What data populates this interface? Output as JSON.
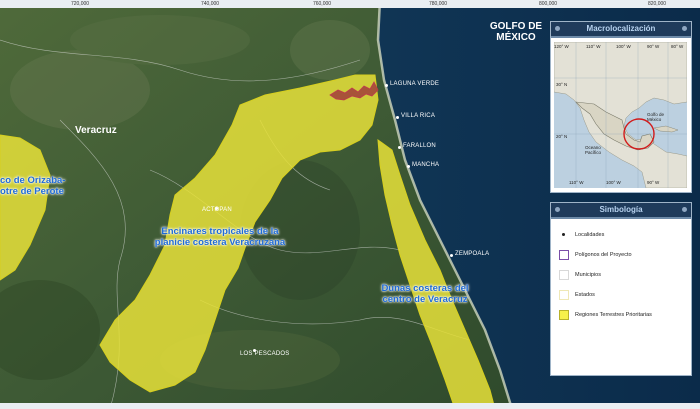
{
  "map": {
    "coord_labels": [
      "720,000",
      "740,000",
      "760,000",
      "780,000",
      "800,000",
      "820,000"
    ],
    "state_label": "Veracruz",
    "gulf_label": "GOLFO DE MÉXICO",
    "places": {
      "laguna_verde": "LAGUNA VERDE",
      "villa_rica": "VILLA RICA",
      "farallon": "FARALLON",
      "mancha": "MANCHA",
      "actopan": "ACTOPAN",
      "zempoala": "ZEMPOALA",
      "los_pescados": "LOS PESCADOS"
    },
    "regions": {
      "encinares": "Encinares tropicales de la planicie costera Veracruzana",
      "dunas": "Dunas costeras del centro de Veracruz",
      "orizaba": "co de Orizaba- otre de Perote"
    },
    "colors": {
      "rtp_fill": "#e8e23a",
      "water": "#0f2f4e",
      "land": "#3f5a36"
    }
  },
  "macro": {
    "title": "Macrolocalización",
    "lon_labels_top": [
      "120° W",
      "110° W",
      "100° W",
      "90° W",
      "80° W"
    ],
    "lon_labels_bottom": [
      "110° W",
      "100° W",
      "90° W"
    ],
    "lat_labels": [
      "30° N",
      "20° N"
    ],
    "gulf_label": "Golfo de México",
    "ocean_label": "Oceano Pacífico",
    "circle_color": "#d21a1a"
  },
  "simbologia": {
    "title": "Simbología",
    "items": [
      {
        "label": "Localidades",
        "swatch": "dot"
      },
      {
        "label": "Polígonos del Proyecto",
        "swatch": "outline",
        "color": "#7a4ea8"
      },
      {
        "label": "Municipios",
        "swatch": "outline",
        "color": "#d8d8d8"
      },
      {
        "label": "Estados",
        "swatch": "outline",
        "color": "#f1ecc0"
      },
      {
        "label": "Regiones Terrestres Prioritarias",
        "swatch": "fill",
        "color": "#f6f04a"
      }
    ]
  }
}
